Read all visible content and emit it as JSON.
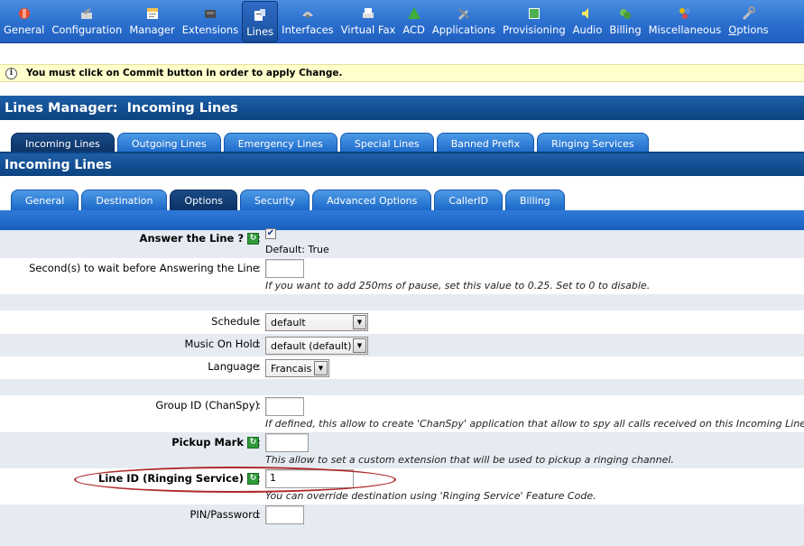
{
  "toolbar": {
    "items": [
      {
        "label": "General",
        "icon": "general-icon",
        "color": "#e84a2a"
      },
      {
        "label": "Configuration",
        "icon": "configuration-icon",
        "color": "#d6d6d6"
      },
      {
        "label": "Manager",
        "icon": "manager-icon",
        "color": "#f2c14e"
      },
      {
        "label": "Extensions",
        "icon": "extensions-icon",
        "color": "#4a4a4a"
      },
      {
        "label": "Lines",
        "icon": "lines-icon",
        "color": "#ffffff"
      },
      {
        "label": "Interfaces",
        "icon": "interfaces-icon",
        "color": "#c9c9c9"
      },
      {
        "label": "Virtual Fax",
        "icon": "fax-icon",
        "color": "#e0e0e0"
      },
      {
        "label": "ACD",
        "icon": "acd-icon",
        "color": "#3fae3a"
      },
      {
        "label": "Applications",
        "icon": "applications-icon",
        "color": "#bdbdbd"
      },
      {
        "label": "Provisioning",
        "icon": "provisioning-icon",
        "color": "#4caf50"
      },
      {
        "label": "Audio",
        "icon": "audio-icon",
        "color": "#f5e663"
      },
      {
        "label": "Billing",
        "icon": "billing-icon",
        "color": "#6fbf5a"
      },
      {
        "label": "Miscellaneous",
        "icon": "miscellaneous-icon",
        "color": "#e6b800"
      },
      {
        "label": "Options",
        "icon": "options-icon",
        "color": "#c4c4c4"
      }
    ],
    "active": "Lines"
  },
  "notice": {
    "text": "You must click on Commit button in order to apply Change."
  },
  "header": {
    "title": "Lines Manager:  Incoming Lines"
  },
  "tabs_primary": [
    {
      "label": "Incoming Lines",
      "active": true
    },
    {
      "label": "Outgoing Lines",
      "active": false
    },
    {
      "label": "Emergency Lines",
      "active": false
    },
    {
      "label": "Special Lines",
      "active": false
    },
    {
      "label": "Banned Prefix",
      "active": false
    },
    {
      "label": "Ringing Services",
      "active": false
    }
  ],
  "section": {
    "title": "Incoming Lines"
  },
  "tabs_secondary": [
    {
      "label": "General",
      "active": false
    },
    {
      "label": "Destination",
      "active": false
    },
    {
      "label": "Options",
      "active": true
    },
    {
      "label": "Security",
      "active": false
    },
    {
      "label": "Advanced Options",
      "active": false
    },
    {
      "label": "CallerID",
      "active": false
    },
    {
      "label": "Billing",
      "active": false
    }
  ],
  "form": {
    "answer": {
      "label": "Answer the Line ?",
      "checked": true,
      "default": "Default: True"
    },
    "wait": {
      "label": "Second(s) to wait before Answering the Line",
      "value": "",
      "hint": "If you want to add 250ms of pause, set this value to 0.25. Set to 0 to disable."
    },
    "schedule": {
      "label": "Schedule",
      "value": "default"
    },
    "moh": {
      "label": "Music On Hold",
      "value": "default (default)"
    },
    "language": {
      "label": "Language",
      "value": "Francais"
    },
    "group": {
      "label": "Group ID (ChanSpy)",
      "value": "",
      "hint": "If defined, this allow to create 'ChanSpy' application that allow to spy all calls received on this Incoming Line."
    },
    "pickup": {
      "label": "Pickup Mark",
      "value": "",
      "hint": "This allow to set a custom extension that will be used to pickup a ringing channel."
    },
    "lineid": {
      "label": "Line ID (Ringing Service)",
      "value": "1",
      "hint": "You can override destination using 'Ringing Service' Feature Code."
    },
    "pin": {
      "label": "PIN/Password",
      "value": ""
    },
    "colon": ":"
  },
  "colors": {
    "accent": "#1c68c9",
    "title_bar": "#0c4280",
    "notice_bg": "#ffffcc",
    "highlight_ring": "#b02a2a"
  }
}
